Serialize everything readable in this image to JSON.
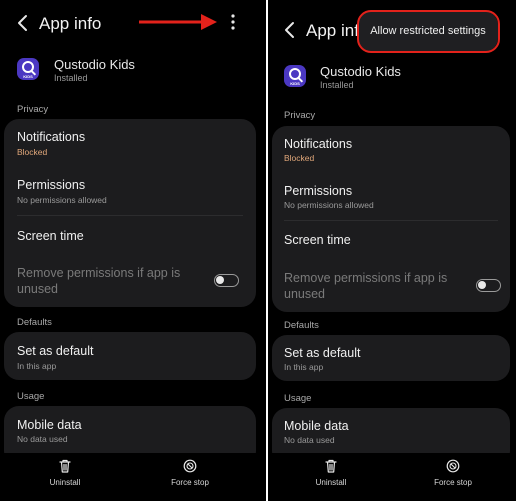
{
  "colors": {
    "background": "#000000",
    "card": "#1c1c1e",
    "status_blocked": "#e0a77a",
    "secondary_text": "#9a9a9a",
    "accent_red": "#e3221b",
    "app_icon": "#4b38c2"
  },
  "icons": {
    "back": "back-arrow-icon",
    "more": "more-vertical-icon",
    "app": "qustodio-kids-app-icon",
    "uninstall": "trash-icon",
    "force_stop": "force-stop-icon",
    "annotation": "red-arrow"
  },
  "header": {
    "title": "App info"
  },
  "app": {
    "name": "Qustodio Kids",
    "status": "Installed",
    "icon_badge": "KIDS"
  },
  "privacy": {
    "label": "Privacy",
    "notifications": {
      "title": "Notifications",
      "subtitle": "Blocked"
    },
    "permissions": {
      "title": "Permissions",
      "subtitle": "No permissions allowed"
    },
    "screen_time": {
      "title": "Screen time"
    },
    "remove_permissions": {
      "title": "Remove permissions if app is unused",
      "enabled": false
    }
  },
  "defaults": {
    "label": "Defaults",
    "set_as_default": {
      "title": "Set as default",
      "subtitle": "In this app"
    }
  },
  "usage": {
    "label": "Usage",
    "mobile_data": {
      "title": "Mobile data",
      "subtitle": "No data used"
    }
  },
  "bottom_bar": {
    "uninstall": "Uninstall",
    "force_stop": "Force stop"
  },
  "overflow_menu": {
    "items": [
      "Allow restricted settings"
    ]
  }
}
